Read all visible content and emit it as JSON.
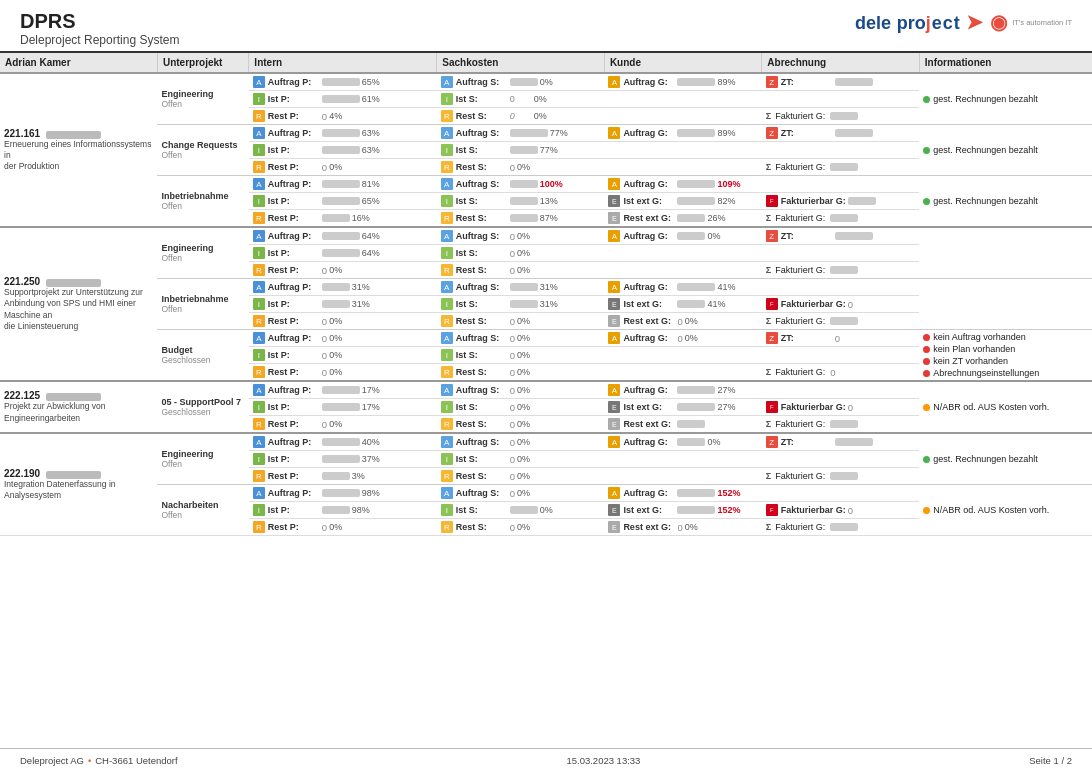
{
  "app": {
    "title": "DPRS",
    "subtitle": "Deleproject Reporting System"
  },
  "logo": {
    "text": "dele project",
    "tagline": "IT's automation IT"
  },
  "header_columns": [
    "Adrian Kamer",
    "Unterprojekt",
    "Intern",
    "Sachkosten",
    "Kunde",
    "Abrechnung",
    "Informationen"
  ],
  "footer": {
    "company": "Deleproject AG",
    "address": "CH-3661 Uetendorf",
    "date": "15.03.2023 13:33",
    "page": "Seite  1 / 2"
  },
  "labels": {
    "auftrag_p": "Auftrag P:",
    "ist_p": "Ist P:",
    "rest_p": "Rest P:",
    "auftrag_s": "Auftrag S:",
    "ist_s": "Ist S:",
    "rest_s": "Rest S:",
    "auftrag_g": "Auftrag G:",
    "ist_ext_g": "Ist ext G:",
    "rest_ext_g": "Rest ext G:",
    "zt": "ZT:",
    "fakturierbar_g": "Fakturierbar G:",
    "fakturiert_g": "Fakturiert G:",
    "gest_rechnungen": "gest. Rechnungen bezahlt",
    "kein_auftrag": "kein Auftrag vorhanden",
    "kein_plan": "kein Plan vorhanden",
    "kein_zt": "kein ZT vorhanden",
    "abrechnungs": "Abrechnungseinstellungen",
    "nabr": "N/ABR od. AUS Kosten vorh."
  }
}
